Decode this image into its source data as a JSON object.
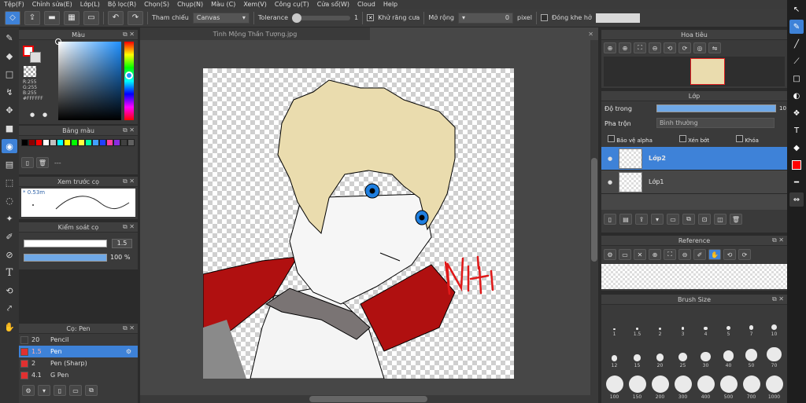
{
  "menu": [
    "Tệp(F)",
    "Chỉnh sửa(E)",
    "Lớp(L)",
    "Bộ lọc(R)",
    "Chọn(S)",
    "Chụp(N)",
    "Màu (C)",
    "Xem(V)",
    "Công cụ(T)",
    "Cửa sổ(W)",
    "Cloud",
    "Help"
  ],
  "toolbar": {
    "reference_label": "Tham chiếu",
    "reference_value": "Canvas",
    "tolerance_label": "Tolerance",
    "tolerance_value": "1",
    "antialias_label": "Khử răng cưa",
    "expand_label": "Mở rộng",
    "expand_value": "0",
    "expand_unit": "pixel",
    "close_gap_label": "Đóng khe hở"
  },
  "color_panel": {
    "title": "Màu",
    "r": "R:255",
    "g": "G:255",
    "b": "B:255",
    "hex": "#FFFFFF",
    "accent": "#3e82d8"
  },
  "palette_panel": {
    "title": "Bảng màu",
    "dashes": "---",
    "colors": [
      "#000000",
      "#8b0000",
      "#ff0000",
      "#ffffff",
      "#c0c0c0",
      "#00ffff",
      "#ffff00",
      "#00ff00",
      "#ffff40",
      "#00ffa0",
      "#40a0ff",
      "#2040ff",
      "#ff40a0",
      "#8a2be2",
      "#404040",
      "#606060"
    ]
  },
  "preview_panel": {
    "title": "Xem trước cọ",
    "size": "* 0.53m"
  },
  "brush_control": {
    "title": "Kiểm soát cọ",
    "size_value": "1.5",
    "opacity_value": "100 %"
  },
  "brush_list": {
    "title": "Cọ: Pen",
    "items": [
      {
        "size": "20",
        "name": "Pencil",
        "color": "#3a3a3a"
      },
      {
        "size": "1.5",
        "name": "Pen",
        "color": "#e03030"
      },
      {
        "size": "2",
        "name": "Pen (Sharp)",
        "color": "#e03030"
      },
      {
        "size": "4.1",
        "name": "G Pen",
        "color": "#e03030"
      }
    ]
  },
  "document": {
    "tab": "Tình Mộng Thần Tượng.jpg",
    "signature": "NHi"
  },
  "navigator": {
    "title": "Hoa tiêu"
  },
  "layers": {
    "title": "Lớp",
    "opacity_label": "Độ trong",
    "opacity_value": "10",
    "blend_label": "Pha trộn",
    "blend_value": "Bình thường",
    "protect_alpha": "Bảo vệ alpha",
    "clipping": "Xén bớt",
    "lock": "Khóa",
    "items": [
      {
        "name": "Lớp2",
        "selected": true
      },
      {
        "name": "Lớp1",
        "selected": false
      }
    ]
  },
  "reference": {
    "title": "Reference"
  },
  "brush_size": {
    "title": "Brush Size",
    "sizes": [
      "1",
      "1.5",
      "2",
      "3",
      "4",
      "5",
      "7",
      "10",
      "12",
      "15",
      "20",
      "25",
      "30",
      "40",
      "50",
      "70",
      "100",
      "150",
      "200",
      "300",
      "400",
      "500",
      "700",
      "1000"
    ]
  },
  "colors": {
    "accent": "#3e82d8",
    "fg": "#ff0000",
    "bg": "#ffffff"
  }
}
